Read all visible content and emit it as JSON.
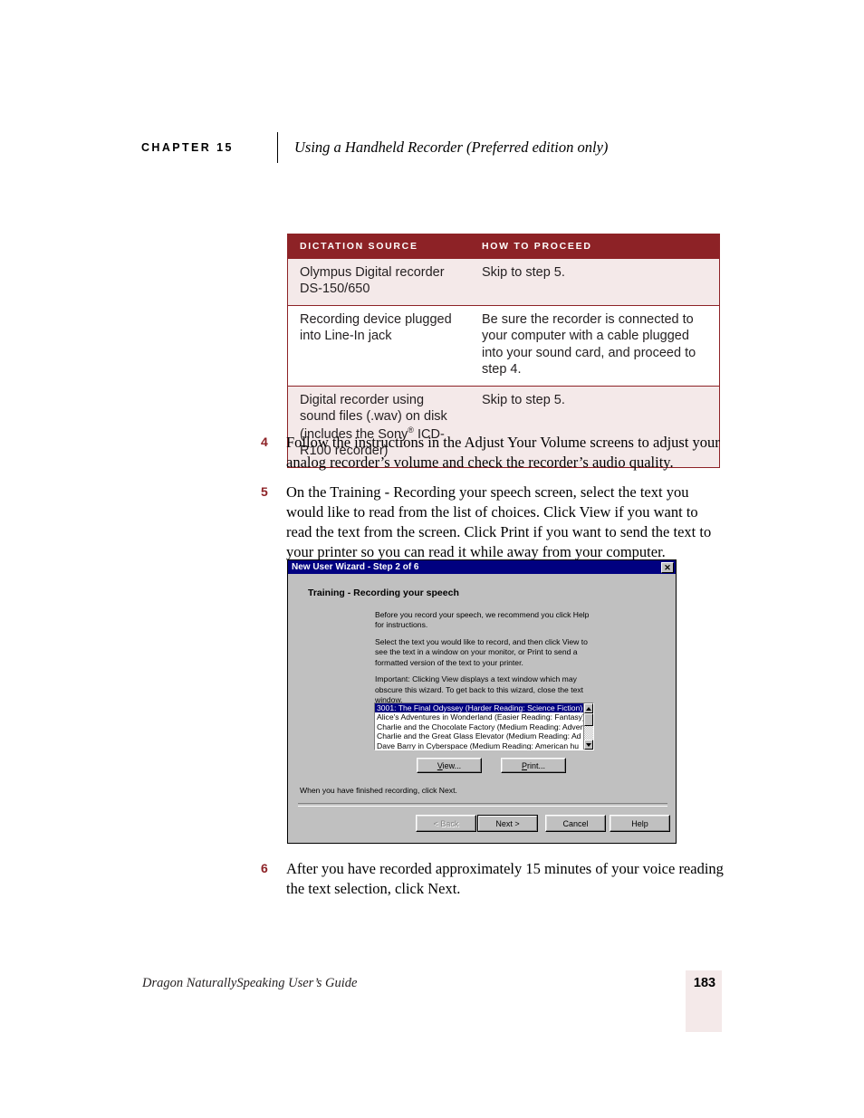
{
  "running_head": {
    "chapter_label": "CHAPTER 15",
    "chapter_title": "Using a Handheld Recorder (Preferred edition only)"
  },
  "table": {
    "headers": [
      "DICTATION SOURCE",
      "HOW TO PROCEED"
    ],
    "rows": [
      {
        "source": "Olympus Digital recorder DS-150/650",
        "proceed": "Skip to step 5."
      },
      {
        "source": "Recording device plugged into Line-In jack",
        "proceed": "Be sure the recorder is connected to your computer with a cable plugged into your sound card, and proceed to step 4."
      },
      {
        "source_part1": "Digital recorder using sound files (.wav) on disk (includes the Sony",
        "source_sup": "®",
        "source_part2": " ICD-R100 recorder)",
        "proceed": "Skip to step 5."
      }
    ],
    "header_color": "#8D2226",
    "tint_color": "#F4E9E9"
  },
  "steps": {
    "step4": {
      "number": "4",
      "text": "Follow the instructions in the Adjust Your Volume screens to adjust your analog recorder’s volume and check the recorder’s audio quality."
    },
    "step5": {
      "number": "5",
      "text": "On the Training - Recording your speech screen, select the text you would like to read from the list of choices. Click View if you want to read the text from the screen. Click Print if you want to send the text to your printer so you can read it while away from your computer."
    },
    "step6": {
      "number": "6",
      "text": "After you have recorded approximately 15 minutes of your voice reading the text selection, click Next."
    }
  },
  "dialog": {
    "title": "New User Wizard - Step 2 of 6",
    "close_glyph": "✕",
    "heading": "Training - Recording your speech",
    "paragraphs": [
      "Before you record your speech, we recommend you click Help for instructions.",
      "Select the text you would like to record, and then click View to see the text in a window on your monitor, or Print to send a formatted version of the text to your printer.",
      "Important: Clicking View displays a text window which may obscure this wizard.  To get back to this wizard, close the text window."
    ],
    "listbox": {
      "items": [
        "3001: The Final Odyssey (Harder Reading: Science Fiction)",
        "Alice's Adventures in Wonderland (Easier Reading: Fantasy)",
        "Charlie and the Chocolate Factory (Medium Reading: Adven",
        "Charlie and the Great Glass Elevator (Medium Reading: Ad",
        "Dave Barry in Cyberspace (Medium Reading: American hu"
      ],
      "selected_index": 0
    },
    "buttons": {
      "view": "View...",
      "print": "Print...",
      "back": "< Back",
      "next": "Next >",
      "cancel": "Cancel",
      "help": "Help"
    },
    "note": "When you have finished recording, click Next.",
    "titlebar_color": "#000080",
    "face_color": "#C0C0C0"
  },
  "footer": {
    "title": "Dragon NaturallySpeaking User’s Guide",
    "page_number": "183"
  }
}
